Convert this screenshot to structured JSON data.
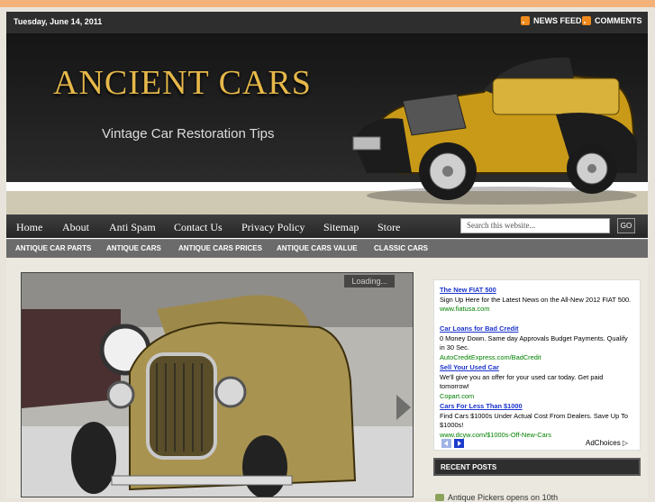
{
  "topbar": {
    "date": "Tuesday, June 14, 2011",
    "news_feed": "NEWS FEED",
    "comments": "COMMENTS"
  },
  "header": {
    "site_title": "ANCIENT CARS",
    "tagline": "Vintage Car Restoration Tips"
  },
  "nav": {
    "items": [
      "Home",
      "About",
      "Anti Spam",
      "Contact Us",
      "Privacy Policy",
      "Sitemap",
      "Store"
    ],
    "search_placeholder": "Search this website...",
    "go_label": "GO"
  },
  "categories": [
    "ANTIQUE CAR PARTS",
    "ANTIQUE CARS",
    "ANTIQUE CARS PRICES",
    "ANTIQUE CARS VALUE",
    "CLASSIC CARS"
  ],
  "feature": {
    "loading": "Loading..."
  },
  "ads": [
    {
      "title": "The New FIAT 500",
      "text": "Sign Up Here for the Latest News on the All-New 2012 FIAT 500.",
      "url": "www.fiatusa.com"
    },
    {
      "title": "Car Loans for Bad Credit",
      "text": "0 Money Down. Same day Approvals Budget Payments. Qualify in 30 Sec.",
      "url": "AutoCreditExpress.com/BadCredit"
    },
    {
      "title": "Sell Your Used Car",
      "text": "We'll give you an offer for your used car today. Get paid tomorrow!",
      "url": "Copart.com"
    },
    {
      "title": "Cars For Less Than $1000",
      "text": "Find Cars $1000s Under Actual Cost From Dealers. Save Up To $1000s!",
      "url": "www.dcyw.com/$1000s-Off-New-Cars"
    }
  ],
  "adchoices": "AdChoices",
  "sidebar": {
    "recent_posts_title": "RECENT POSTS",
    "recent_posts": [
      "Antique Pickers opens on 10th"
    ]
  }
}
